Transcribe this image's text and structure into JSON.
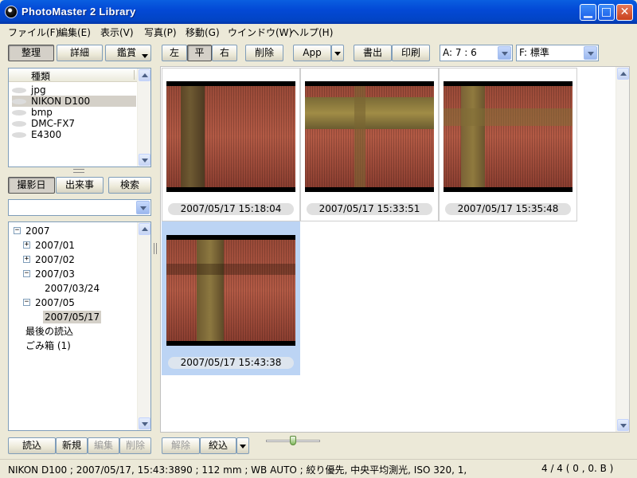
{
  "window": {
    "title": "PhotoMaster 2 Library"
  },
  "menu": [
    "ファイル(F)",
    "編集(E)",
    "表示(V)",
    "写真(P)",
    "移動(G)",
    "ウインドウ(W)",
    "ヘルプ(H)"
  ],
  "toolbar": {
    "organize": "整理",
    "details": "詳細",
    "view": "鑑賞",
    "left": "左",
    "flat": "平",
    "right": "右",
    "delete": "削除",
    "app": "App",
    "export": "書出",
    "print": "印刷",
    "aspect_value": "A: 7 : 6",
    "filter_value": "F: 標準"
  },
  "types_panel": {
    "header": "種類",
    "items": [
      "jpg",
      "NIKON D100",
      "bmp",
      "DMC-FX7",
      "E4300"
    ],
    "selected": "NIKON D100"
  },
  "nav_tabs": {
    "date_taken": "撮影日",
    "events": "出来事",
    "search": "検索"
  },
  "date_combo_value": "",
  "tree": {
    "year": "2007",
    "m01": "2007/01",
    "m02": "2007/02",
    "m03": "2007/03",
    "d0324": "2007/03/24",
    "m05": "2007/05",
    "d0517": "2007/05/17",
    "last_import": "最後の読込",
    "trash": "ごみ箱 (1)"
  },
  "photos": [
    {
      "caption": "2007/05/17 15:18:04"
    },
    {
      "caption": "2007/05/17 15:33:51"
    },
    {
      "caption": "2007/05/17 15:35:48"
    },
    {
      "caption": "2007/05/17 15:43:38"
    }
  ],
  "bottom_left": {
    "import": "読込",
    "new": "新規",
    "edit": "編集",
    "delete": "削除"
  },
  "bottom_mid": {
    "release": "解除",
    "narrow": "絞込"
  },
  "status": {
    "info": "NIKON D100 ; 2007/05/17, 15:43:3890 ; 112 mm ; WB AUTO ; 絞り優先, 中央平均測光, ISO 320, 1,",
    "count": "4 / 4 ( 0 , 0. B )"
  }
}
